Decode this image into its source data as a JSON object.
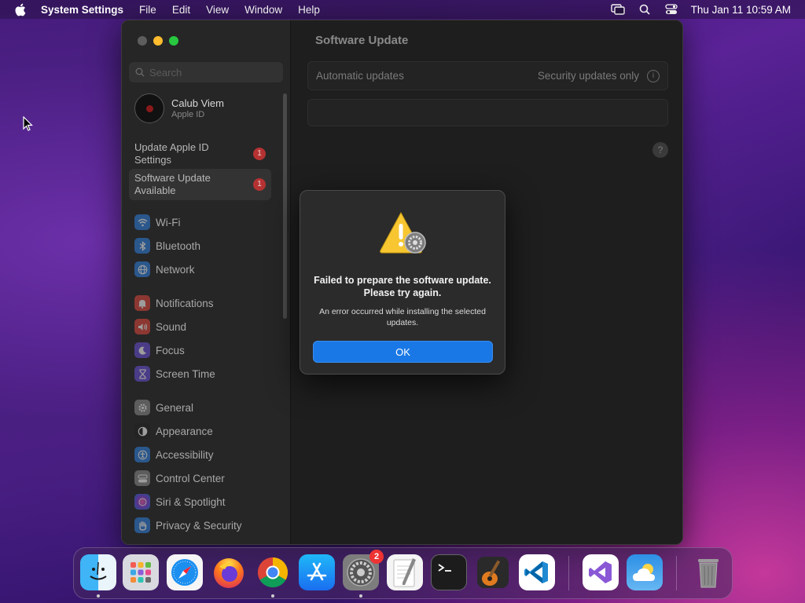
{
  "menubar": {
    "app_name": "System Settings",
    "menus": [
      "File",
      "Edit",
      "View",
      "Window",
      "Help"
    ],
    "clock": "Thu Jan 11  10:59 AM"
  },
  "sidebar": {
    "search_placeholder": "Search",
    "profile": {
      "name": "Calub Viem",
      "subtitle": "Apple ID"
    },
    "notices": [
      {
        "label": "Update Apple ID Settings",
        "badge": "1"
      },
      {
        "label": "Software Update Available",
        "badge": "1"
      }
    ],
    "items": [
      {
        "label": "Wi-Fi",
        "icon": "wifi-icon",
        "color": "#2f7fe0"
      },
      {
        "label": "Bluetooth",
        "icon": "bluetooth-icon",
        "color": "#2f7fe0"
      },
      {
        "label": "Network",
        "icon": "globe-icon",
        "color": "#2f7fe0"
      },
      {
        "label": "Notifications",
        "icon": "bell-icon",
        "color": "#e0453a"
      },
      {
        "label": "Sound",
        "icon": "speaker-icon",
        "color": "#e0453a"
      },
      {
        "label": "Focus",
        "icon": "moon-icon",
        "color": "#6a4fd8"
      },
      {
        "label": "Screen Time",
        "icon": "hourglass-icon",
        "color": "#6a4fd8"
      },
      {
        "label": "General",
        "icon": "gear-icon",
        "color": "#8a8a8a"
      },
      {
        "label": "Appearance",
        "icon": "appearance-icon",
        "color": "#222222"
      },
      {
        "label": "Accessibility",
        "icon": "accessibility-icon",
        "color": "#2f7fe0"
      },
      {
        "label": "Control Center",
        "icon": "control-center-icon",
        "color": "#8a8a8a"
      },
      {
        "label": "Siri & Spotlight",
        "icon": "siri-icon",
        "color": "#c03ad0"
      },
      {
        "label": "Privacy & Security",
        "icon": "hand-icon",
        "color": "#2f7fe0"
      }
    ]
  },
  "content": {
    "title": "Software Update",
    "automatic_label": "Automatic updates",
    "automatic_value": "Security updates only",
    "help": "?"
  },
  "dialog": {
    "title": "Failed to prepare the software update. Please try again.",
    "message": "An error occurred while installing the selected updates.",
    "ok_label": "OK"
  },
  "dock": {
    "settings_badge": "2",
    "apps": [
      "Finder",
      "Launchpad",
      "Safari",
      "Firefox",
      "Chrome",
      "App Store",
      "System Settings",
      "TextEdit",
      "Terminal",
      "GarageBand",
      "Visual Studio Code",
      "Visual Studio",
      "Weather",
      "Trash"
    ]
  }
}
